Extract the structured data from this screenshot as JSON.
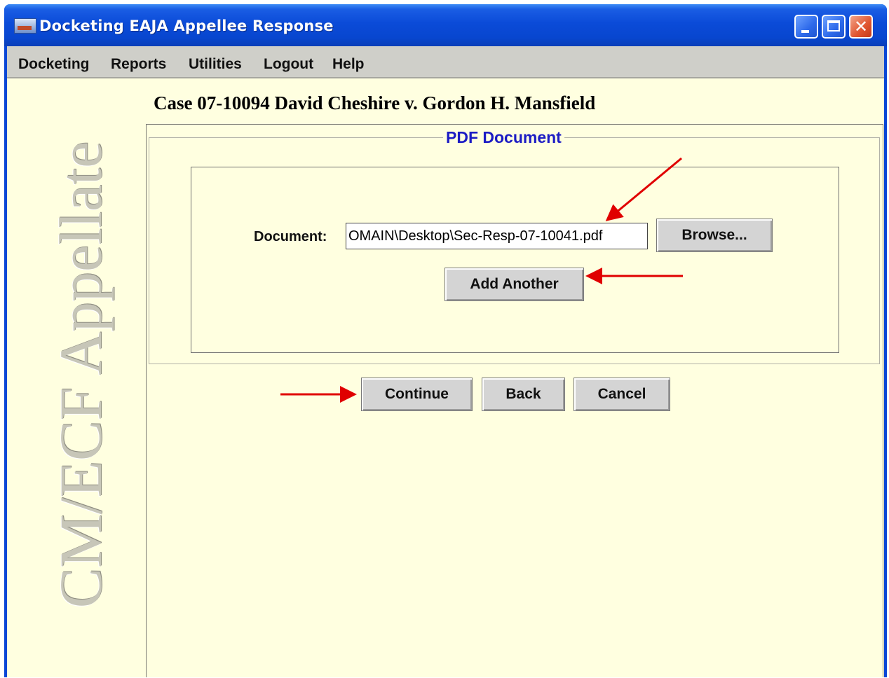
{
  "window": {
    "title": "Docketing EAJA Appellee Response",
    "title_color": "#0a47d6",
    "icon": "app-icon",
    "controls": [
      "minimize-icon",
      "maximize-icon",
      "close-icon"
    ]
  },
  "menu": {
    "items": [
      "Docketing",
      "Reports",
      "Utilities",
      "Logout",
      "Help"
    ]
  },
  "sidebar": {
    "logo_text": "CM/ECF Appellate"
  },
  "case": {
    "title": "Case 07-10094 David Cheshire v. Gordon H. Mansfield"
  },
  "pdf_section": {
    "legend": "PDF Document",
    "legend_color": "#1c1cc4",
    "document_label": "Document:",
    "document_value": "OMAIN\\Desktop\\Sec-Resp-07-10041.pdf",
    "browse_label": "Browse...",
    "add_another_label": "Add Another"
  },
  "actions": {
    "continue_label": "Continue",
    "back_label": "Back",
    "cancel_label": "Cancel"
  },
  "annotations": {
    "arrow_color": "#e00000",
    "arrow_targets": [
      "document-field",
      "add-another-button",
      "continue-button"
    ]
  }
}
